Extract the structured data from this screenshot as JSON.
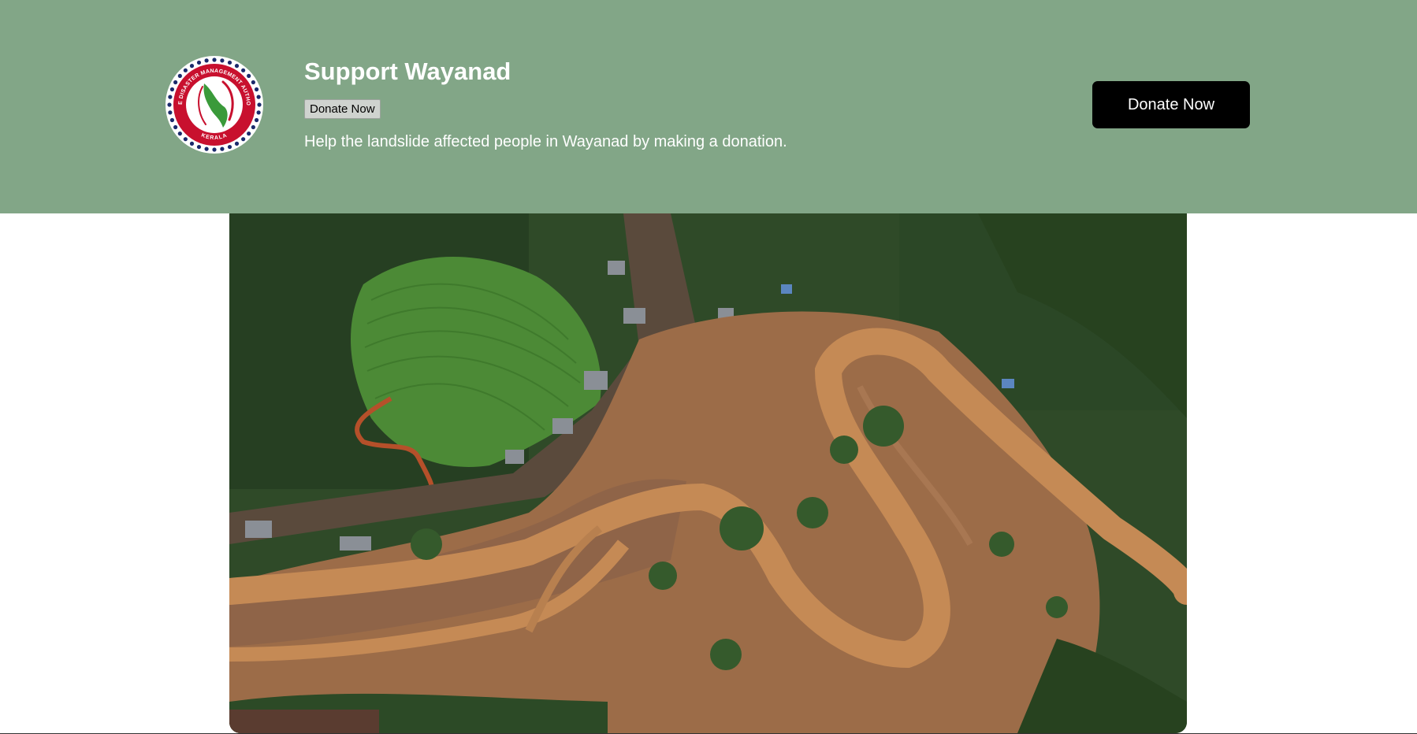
{
  "banner": {
    "title": "Support Wayanad",
    "small_button_label": "Donate Now",
    "description": "Help the landslide affected people in Wayanad by making a donation.",
    "cta_button_label": "Donate Now",
    "background_color": "#82a687"
  },
  "logo": {
    "ring_text_top": "STATE DISASTER MANAGEMENT AUTHORITY",
    "ring_text_bottom": "KERALA",
    "colors": {
      "ring": "#c8102e",
      "dots": "#1a2a6c",
      "map": "#3a9a3a"
    }
  },
  "hero_image": {
    "icon": "aerial-landslide-photo",
    "colors": {
      "forest": "#2f4a28",
      "mud": "#b07848",
      "river": "#c58a55"
    }
  }
}
